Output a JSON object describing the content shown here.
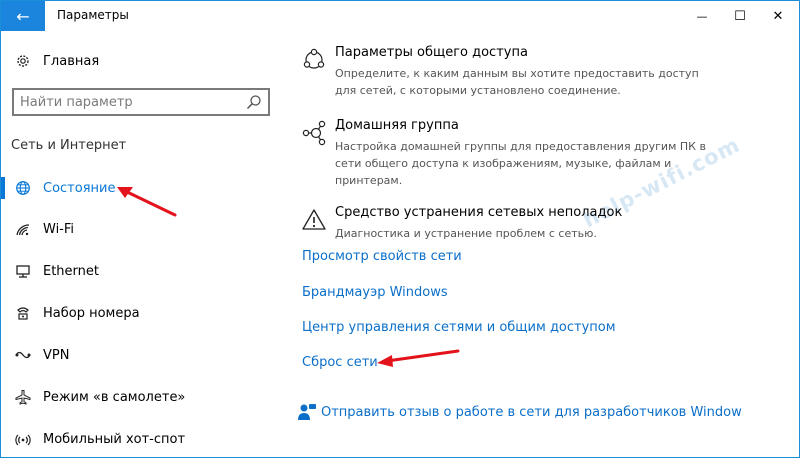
{
  "window": {
    "title": "Параметры",
    "back_icon": "←",
    "minimize_icon": "—",
    "maximize_icon": "☐",
    "close_icon": "✕"
  },
  "sidebar": {
    "home_label": "Главная",
    "search_placeholder": "Найти параметр",
    "section_title": "Сеть и Интернет",
    "items": [
      {
        "label": "Состояние",
        "icon": "globe-icon",
        "selected": true
      },
      {
        "label": "Wi-Fi",
        "icon": "wifi-icon"
      },
      {
        "label": "Ethernet",
        "icon": "ethernet-icon"
      },
      {
        "label": "Набор номера",
        "icon": "phone-icon"
      },
      {
        "label": "VPN",
        "icon": "vpn-icon"
      },
      {
        "label": "Режим «в самолете»",
        "icon": "airplane-icon"
      },
      {
        "label": "Мобильный хот-спот",
        "icon": "hotspot-icon"
      }
    ]
  },
  "main": {
    "sharing": {
      "title": "Параметры общего доступа",
      "desc": "Определите, к каким данным вы хотите предоставить доступ для сетей, с которыми установлено соединение."
    },
    "homegroup": {
      "title": "Домашняя группа",
      "desc": "Настройка домашней группы для предоставления другим ПК в сети общего доступа к изображениям, музыке, файлам и принтерам."
    },
    "troubleshoot": {
      "title": "Средство устранения сетевых неполадок",
      "desc": "Диагностика и устранение проблем с сетью."
    },
    "links": {
      "view_props": "Просмотр свойств сети",
      "firewall": "Брандмауэр Windows",
      "network_center": "Центр управления сетями и общим доступом",
      "reset": "Сброс сети",
      "feedback": "Отправить отзыв о работе в сети для разработчиков Window"
    },
    "watermark": "help-wifi.com"
  },
  "colors": {
    "accent": "#0b78d7",
    "link": "#0b6fc9",
    "arrow": "#e3121b"
  }
}
